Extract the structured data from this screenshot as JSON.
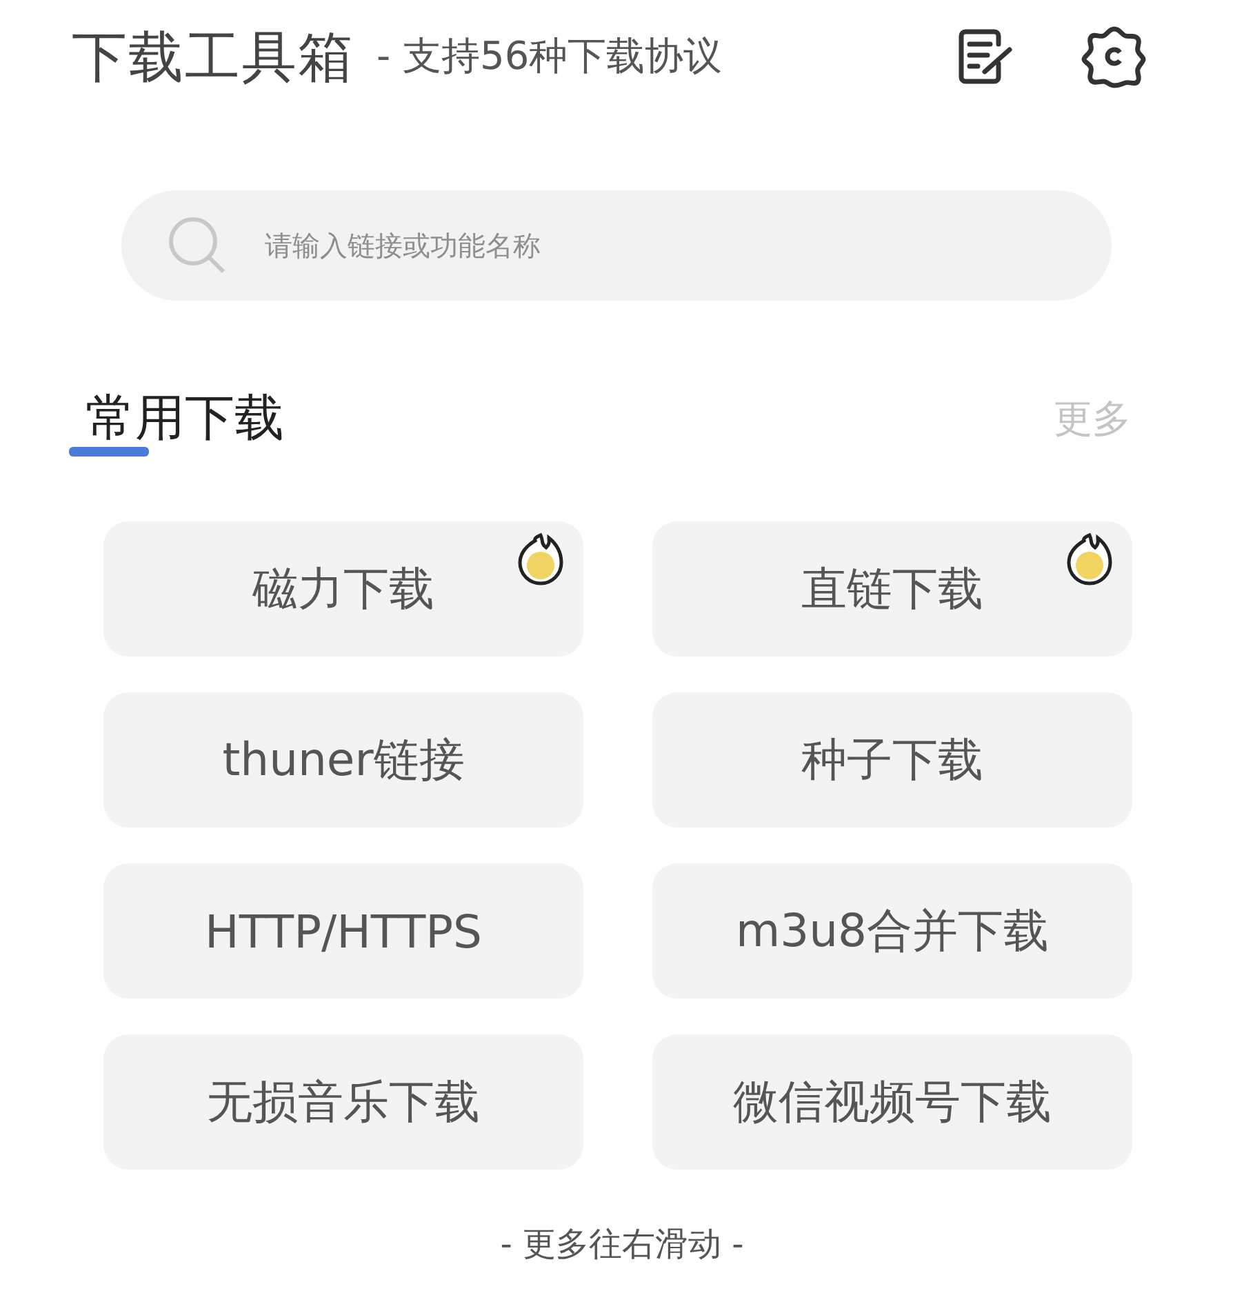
{
  "header": {
    "title": "下载工具箱",
    "subtitle": "- 支持56种下载协议"
  },
  "search": {
    "placeholder": "请输入链接或功能名称"
  },
  "section": {
    "title": "常用下载",
    "more": "更多"
  },
  "tools": [
    {
      "label": "磁力下载",
      "hot": true
    },
    {
      "label": "直链下载",
      "hot": true
    },
    {
      "label": "thuner链接",
      "hot": false
    },
    {
      "label": "种子下载",
      "hot": false
    },
    {
      "label": "HTTP/HTTPS",
      "hot": false
    },
    {
      "label": "m3u8合并下载",
      "hot": false
    },
    {
      "label": "无损音乐下载",
      "hot": false
    },
    {
      "label": "微信视频号下载",
      "hot": false
    }
  ],
  "footer": "- 更多往右滑动 -"
}
